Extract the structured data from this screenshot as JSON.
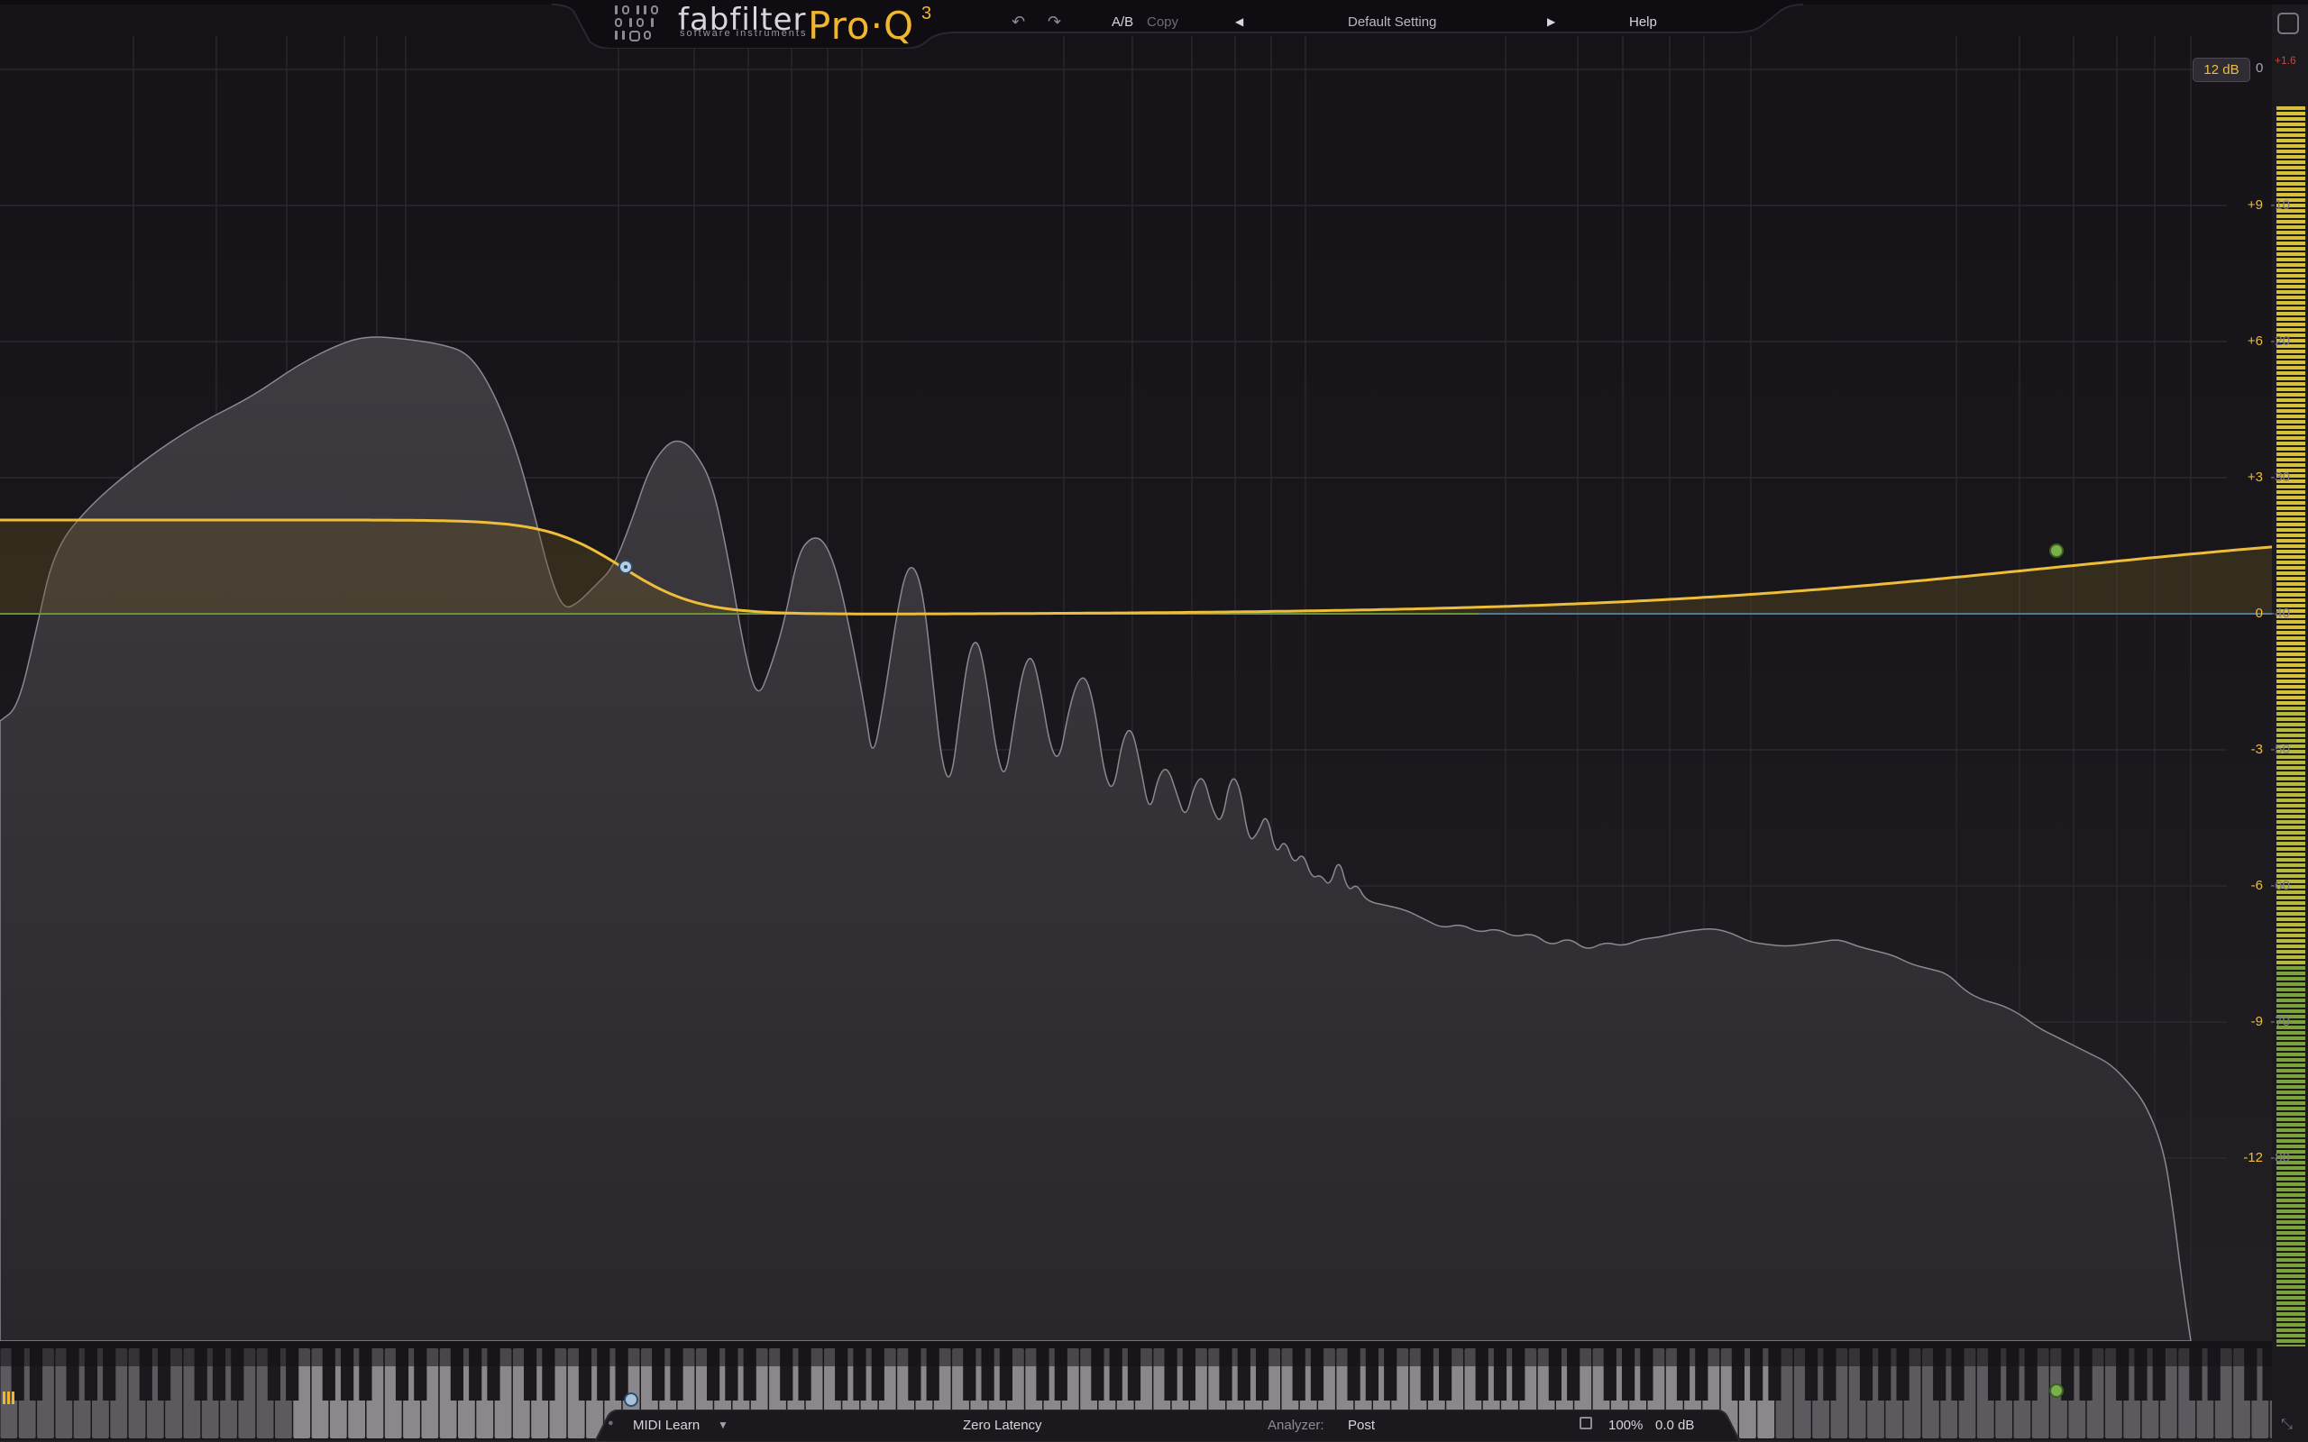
{
  "header": {
    "brand": "fabfilter",
    "brand_sub": "software instruments",
    "product": "Pro·Q",
    "product_version": "3",
    "ab_label": "A/B",
    "copy_label": "Copy",
    "preset_name": "Default Setting",
    "help_label": "Help",
    "undo_icon": "undo-icon",
    "redo_icon": "redo-icon",
    "prev_icon": "triangle-left-icon",
    "next_icon": "triangle-right-icon",
    "fullscreen_icon": "fullscreen-icon"
  },
  "scale": {
    "range_label": "12 dB",
    "meter_zero": "0",
    "meter_peak": "+1.6",
    "eq_ticks": [
      "+9",
      "+6",
      "+3",
      "0",
      "-3",
      "-6",
      "-9",
      "-12"
    ],
    "analyzer_ticks": [
      "-10",
      "-20",
      "-30",
      "-40",
      "-50",
      "-60",
      "-70",
      "-80"
    ]
  },
  "bands": [
    {
      "id": 1,
      "type": "low-shelf",
      "color": "#a9c2d8",
      "note": "A#2"
    },
    {
      "id": 2,
      "type": "high-shelf",
      "color": "#7ab04a",
      "note": "B7"
    }
  ],
  "colors": {
    "eq_curve": "#eebd3a",
    "zero_line_left": "#5ea83a",
    "zero_line_right": "#3d86c6",
    "meter": "#d7c13a"
  },
  "footer": {
    "midi_learn": "MIDI Learn",
    "latency": "Zero Latency",
    "analyzer_label": "Analyzer:",
    "analyzer_value": "Post",
    "zoom": "100%",
    "output_gain": "0.0 dB",
    "midi_icon": "power-icon",
    "dropdown_icon": "chevron-down-icon",
    "zoom_icon": "zoom-icon",
    "resize_icon": "resize-icon"
  }
}
